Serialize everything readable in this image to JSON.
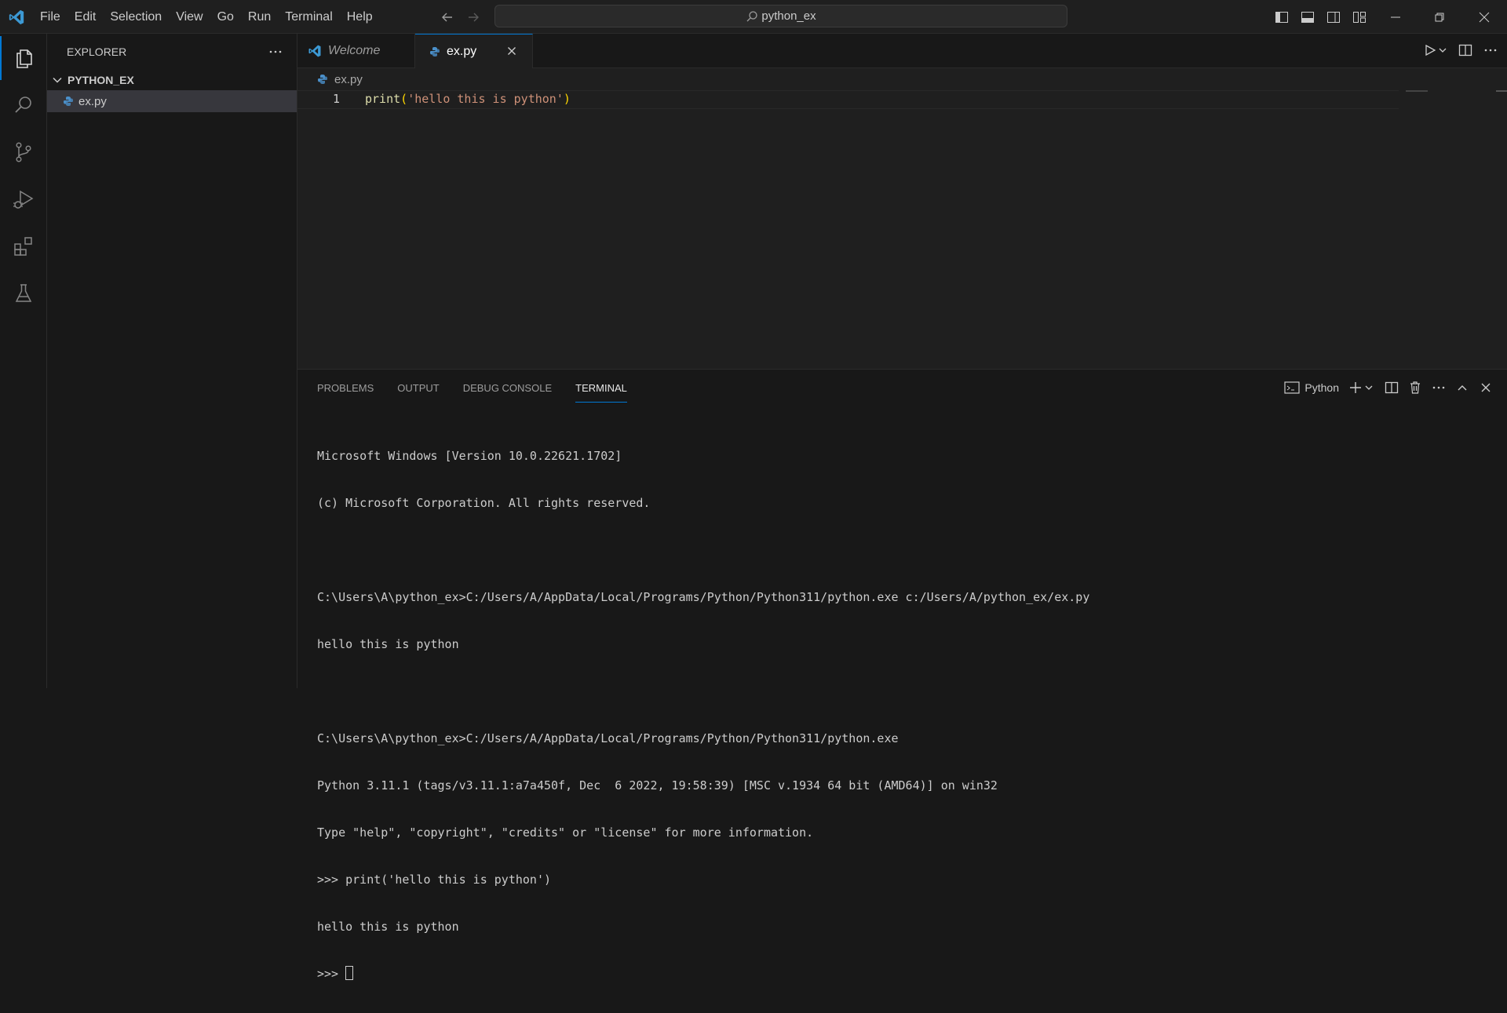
{
  "menu": [
    "File",
    "Edit",
    "Selection",
    "View",
    "Go",
    "Run",
    "Terminal",
    "Help"
  ],
  "command_center": {
    "text": "python_ex"
  },
  "sidebar": {
    "title": "EXPLORER",
    "folder": "PYTHON_EX",
    "files": [
      "ex.py"
    ]
  },
  "tabs": [
    {
      "label": "Welcome",
      "icon": "vscode-logo-icon"
    },
    {
      "label": "ex.py",
      "icon": "python-icon",
      "active": true
    }
  ],
  "breadcrumb": "ex.py",
  "editor": {
    "line_number": "1",
    "code": {
      "fn": "print",
      "open": "(",
      "str": "'hello this is python'",
      "close": ")"
    }
  },
  "panel": {
    "tabs": [
      "PROBLEMS",
      "OUTPUT",
      "DEBUG CONSOLE",
      "TERMINAL"
    ],
    "active_tab": "TERMINAL",
    "terminal_name": "Python",
    "terminal_lines": [
      "Microsoft Windows [Version 10.0.22621.1702]",
      "(c) Microsoft Corporation. All rights reserved.",
      "",
      "C:\\Users\\A\\python_ex>C:/Users/A/AppData/Local/Programs/Python/Python311/python.exe c:/Users/A/python_ex/ex.py",
      "hello this is python",
      "",
      "C:\\Users\\A\\python_ex>C:/Users/A/AppData/Local/Programs/Python/Python311/python.exe",
      "Python 3.11.1 (tags/v3.11.1:a7a450f, Dec  6 2022, 19:58:39) [MSC v.1934 64 bit (AMD64)] on win32",
      "Type \"help\", \"copyright\", \"credits\" or \"license\" for more information.",
      ">>> print('hello this is python')",
      "hello this is python"
    ],
    "prompt": ">>> "
  },
  "colors": {
    "accent": "#0078d4",
    "background": "#181818",
    "editor_bg": "#1f1f1f"
  }
}
